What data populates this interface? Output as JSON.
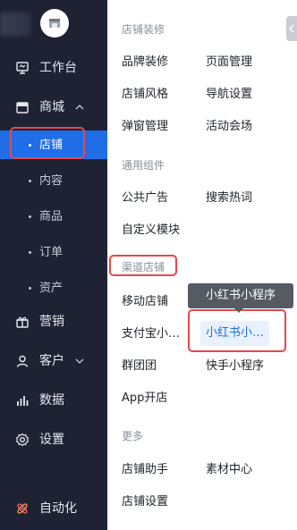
{
  "sidebar": {
    "items": [
      {
        "label": "工作台",
        "icon": "workbench-icon"
      },
      {
        "label": "商城",
        "icon": "mall-icon"
      },
      {
        "label": "营销",
        "icon": "gift-icon"
      },
      {
        "label": "客户",
        "icon": "user-icon"
      },
      {
        "label": "数据",
        "icon": "chart-icon"
      },
      {
        "label": "设置",
        "icon": "gear-icon"
      },
      {
        "label": "自动化",
        "icon": "automation-icon"
      }
    ],
    "mall_children": [
      "店铺",
      "内容",
      "商品",
      "订单",
      "资产"
    ],
    "active_child": "店铺"
  },
  "panel": {
    "sections": [
      {
        "title": "店铺装修",
        "links": [
          "品牌装修",
          "页面管理",
          "店铺风格",
          "导航设置",
          "弹窗管理",
          "活动会场"
        ]
      },
      {
        "title": "通用组件",
        "links": [
          "公共广告",
          "搜索热词",
          "自定义模块"
        ]
      },
      {
        "title": "渠道店铺",
        "links": [
          "移动店铺",
          "支付宝小…",
          "小红书小…",
          "群团团",
          "快手小程序",
          "App开店"
        ]
      },
      {
        "title": "更多",
        "links": [
          "店铺助手",
          "素材中心",
          "店铺设置"
        ]
      }
    ],
    "selected_link": "小红书小…",
    "tooltip": "小红书小程序"
  },
  "colors": {
    "sidebar_bg": "#1e2233",
    "accent": "#1f6ee8",
    "highlight": "#e5484d"
  }
}
